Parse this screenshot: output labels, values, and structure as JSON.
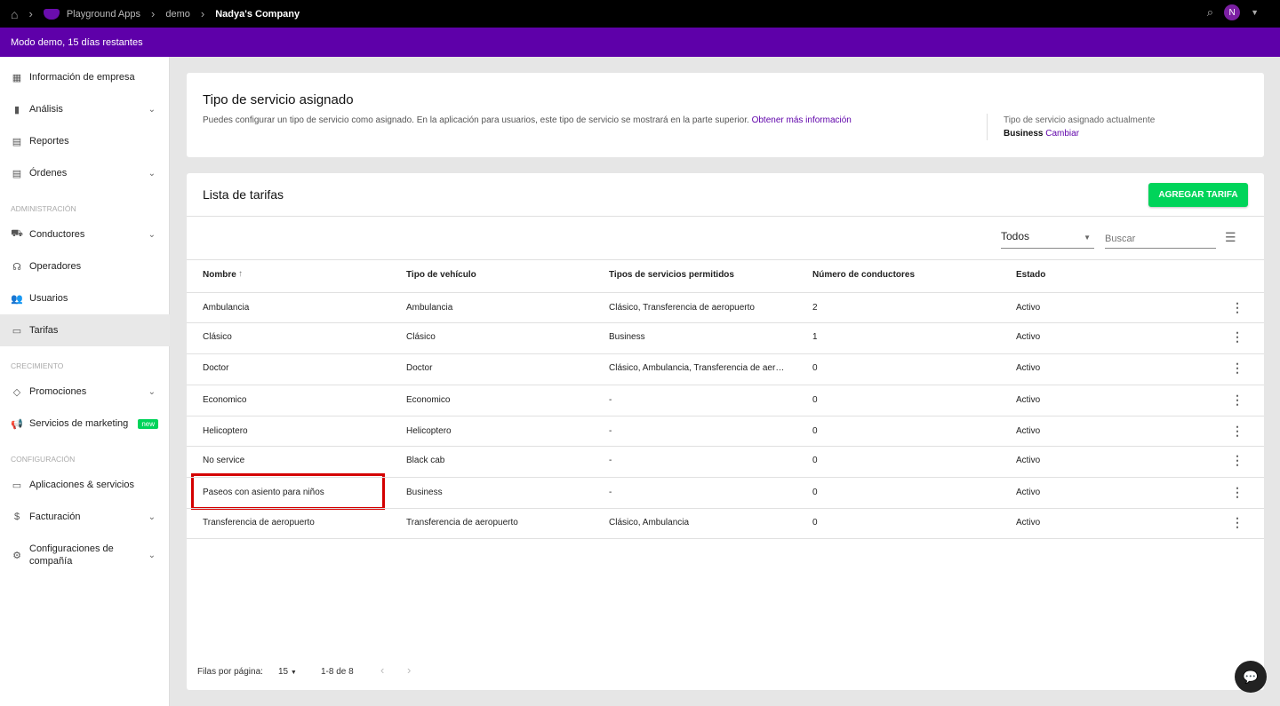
{
  "topbar": {
    "crumbs": [
      "Playground Apps",
      "demo"
    ],
    "current": "Nadya's Company",
    "avatar": "N"
  },
  "banner": "Modo demo, 15 días restantes",
  "sidebar": {
    "items": [
      {
        "label": "Información de empresa",
        "icon": "▦"
      },
      {
        "label": "Análisis",
        "icon": "▮"
      },
      {
        "label": "Reportes",
        "icon": "▤"
      },
      {
        "label": "Órdenes",
        "icon": "▤"
      },
      {
        "label": "Conductores",
        "icon": "⛟"
      },
      {
        "label": "Operadores",
        "icon": "☊"
      },
      {
        "label": "Usuarios",
        "icon": "👥"
      },
      {
        "label": "Tarifas",
        "icon": "▭"
      },
      {
        "label": "Promociones",
        "icon": "◇"
      },
      {
        "label": "Servicios de marketing",
        "icon": "📢"
      },
      {
        "label": "Aplicaciones & servicios",
        "icon": "▭"
      },
      {
        "label": "Facturación",
        "icon": "$"
      },
      {
        "label": "Configuraciones de compañía",
        "icon": "⚙"
      }
    ],
    "sections": [
      "ADMINISTRACIÓN",
      "CRECIMIENTO",
      "CONFIGURACIÓN"
    ],
    "new_badge": "new"
  },
  "assigned": {
    "title": "Tipo de servicio asignado",
    "desc": "Puedes configurar un tipo de servicio como asignado. En la aplicación para usuarios, este tipo de servicio se mostrará en la parte superior.",
    "link": "Obtener más información",
    "current_label": "Tipo de servicio asignado actualmente",
    "current_value": "Business",
    "change": "Cambiar"
  },
  "tariffs": {
    "title": "Lista de tarifas",
    "add": "AGREGAR TARIFA",
    "filter": "Todos",
    "search_placeholder": "Buscar",
    "headers": [
      "Nombre",
      "Tipo de vehículo",
      "Tipos de servicios permitidos",
      "Número de conductores",
      "Estado"
    ],
    "rows": [
      [
        "Ambulancia",
        "Ambulancia",
        "Clásico, Transferencia de aeropuerto",
        "2",
        "Activo"
      ],
      [
        "Clásico",
        "Clásico",
        "Business",
        "1",
        "Activo"
      ],
      [
        "Doctor",
        "Doctor",
        "Clásico, Ambulancia, Transferencia de aer…",
        "0",
        "Activo"
      ],
      [
        "Economico",
        "Economico",
        "-",
        "0",
        "Activo"
      ],
      [
        "Helicoptero",
        "Helicoptero",
        "-",
        "0",
        "Activo"
      ],
      [
        "No service",
        "Black cab",
        "-",
        "0",
        "Activo"
      ],
      [
        "Paseos con asiento para niños",
        "Business",
        "-",
        "0",
        "Activo"
      ],
      [
        "Transferencia de aeropuerto",
        "Transferencia de aeropuerto",
        "Clásico, Ambulancia",
        "0",
        "Activo"
      ]
    ],
    "rows_per_page_label": "Filas por página:",
    "rows_per_page": "15",
    "range": "1-8 de 8"
  }
}
